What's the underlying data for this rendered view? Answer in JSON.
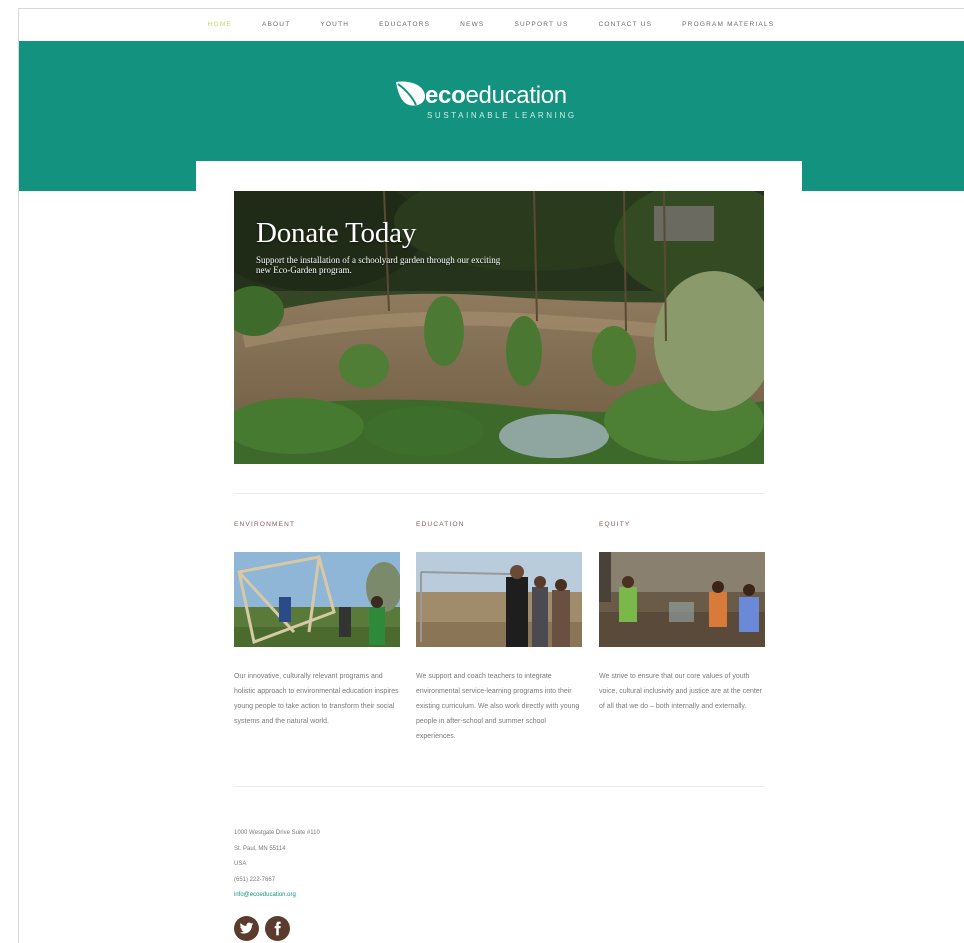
{
  "nav": {
    "items": [
      {
        "label": "HOME",
        "active": true
      },
      {
        "label": "ABOUT",
        "active": false
      },
      {
        "label": "YOUTH",
        "active": false
      },
      {
        "label": "EDUCATORS",
        "active": false
      },
      {
        "label": "NEWS",
        "active": false
      },
      {
        "label": "SUPPORT US",
        "active": false
      },
      {
        "label": "CONTACT US",
        "active": false
      },
      {
        "label": "PROGRAM MATERIALS",
        "active": false
      }
    ]
  },
  "brand": {
    "name_bold": "eco",
    "name_light": "education",
    "tagline": "SUSTAINABLE LEARNING",
    "color": "#13937f",
    "accent": "#c7d45a"
  },
  "hero": {
    "title": "Donate Today",
    "subtitle": "Support the installation of a schoolyard garden through our exciting new Eco-Garden program."
  },
  "columns": [
    {
      "heading": "ENVIRONMENT",
      "text": "Our innovative, culturally relevant programs and holistic approach to environmental education inspires young people to take action to transform their social systems and the natural world."
    },
    {
      "heading": "EDUCATION",
      "text": "We support and coach teachers to integrate environmental service-learning programs into their existing curriculum. We also work directly with young people in after-school and summer school experiences."
    },
    {
      "heading": "EQUITY",
      "text": "We strive to ensure that our core values of youth voice, cultural inclusivity and justice are at the center of all that we do – both internally and externally."
    }
  ],
  "footer": {
    "address1": "1000 Westgate Drive Suite #110",
    "address2": "St. Paul, MN 55114",
    "country": "USA",
    "phone": "(651) 222-7667",
    "email": "info@ecoeducation.org"
  },
  "social": [
    "twitter-icon",
    "facebook-icon"
  ]
}
